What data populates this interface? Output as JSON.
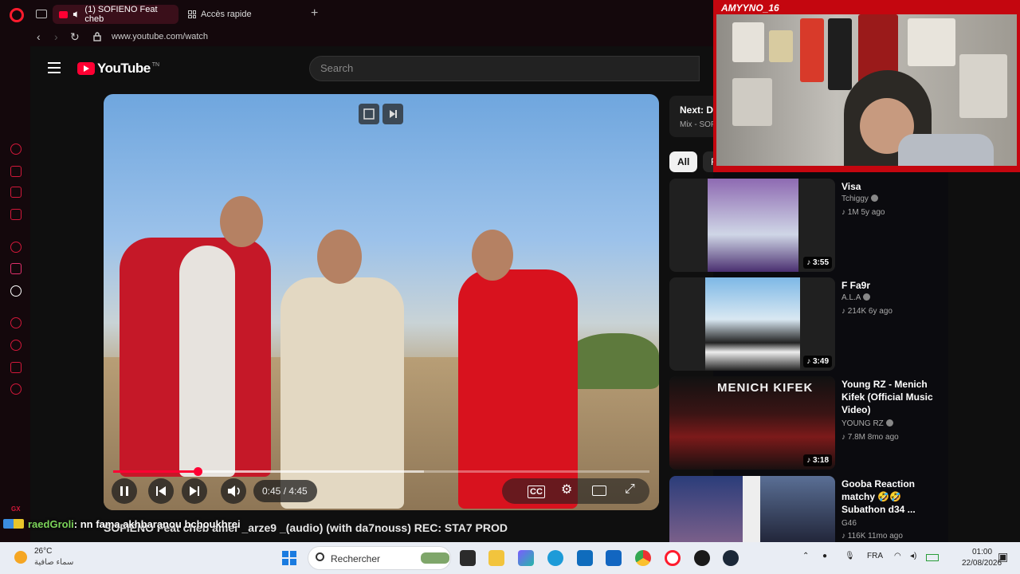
{
  "browser": {
    "active_tab": "(1) SOFIENO Feat cheb",
    "inactive_tab": "Accès rapide",
    "new_tab": "+",
    "url": "www.youtube.com/watch"
  },
  "youtube": {
    "logo_text": "YouTube",
    "logo_tm": "TN",
    "search_placeholder": "Search",
    "video": {
      "current_time": "0:45 / 4:45",
      "progress_fraction": 0.158,
      "title": "SOFIENO Feat cheb amer _arze9 _(audio) (with da7nouss) REC: STA7 PROD"
    },
    "next": {
      "label": "Next: D-",
      "sub": "Mix - SOF"
    },
    "chips": [
      "All",
      "F"
    ],
    "recommendations": [
      {
        "title": "Visa",
        "channel": "Tchiggy",
        "meta": "1M  5y ago",
        "duration": "3:55",
        "thumb_color": "#5b3a80"
      },
      {
        "title": "F Fa9r",
        "channel": "A.L.A",
        "meta": "214K  6y ago",
        "duration": "3:49",
        "thumb_color": "#6aa8d8"
      },
      {
        "title": "Young RZ - Menich Kifek (Official Music Video)",
        "channel": "YOUNG RZ",
        "meta": "7.8M  8mo ago",
        "duration": "3:18",
        "thumb_color": "#2a0f10"
      },
      {
        "title": "Gooba Reaction matchy 🤣🤣 Subathon d34 ...",
        "channel": "G46",
        "meta": "116K  11mo ago",
        "duration": "",
        "thumb_color": "#2f3f6a"
      }
    ]
  },
  "overlay": {
    "streamer_name": "AMYYNO_16",
    "chat_user": "raedGroli",
    "chat_message": ": nn fama akhbaranou bchoukhrei",
    "gx_label": "GX"
  },
  "taskbar": {
    "temperature": "26°C",
    "weather_desc": "سماء صافية",
    "search_placeholder": "Rechercher",
    "language": "FRA",
    "time": "01:00",
    "date": "22/08/2026"
  },
  "colors": {
    "accent": "#ff0033",
    "opera_red": "#d2183a",
    "cam_frame": "#c4060f"
  }
}
